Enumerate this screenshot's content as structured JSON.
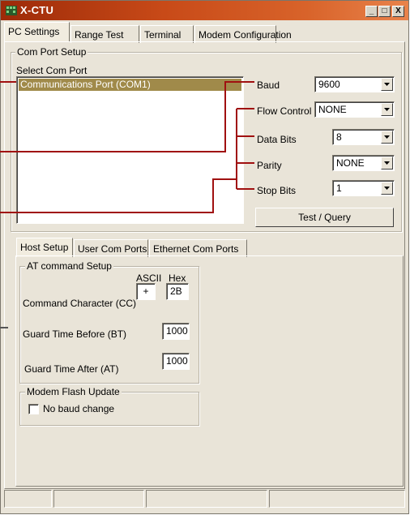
{
  "window": {
    "title": "X-CTU",
    "minimize": "_",
    "maximize": "□",
    "close": "X"
  },
  "main_tabs": [
    "PC Settings",
    "Range Test",
    "Terminal",
    "Modem Configuration"
  ],
  "com_port_setup": {
    "group_label": "Com Port Setup",
    "select_label": "Select Com Port",
    "ports": [
      "Communications Port (COM1)"
    ],
    "selected_index": 0
  },
  "serial": {
    "baud_label": "Baud",
    "baud_value": "9600",
    "flow_label": "Flow Control",
    "flow_value": "NONE",
    "data_bits_label": "Data Bits",
    "data_bits_value": "8",
    "parity_label": "Parity",
    "parity_value": "NONE",
    "stop_bits_label": "Stop Bits",
    "stop_bits_value": "1",
    "test_button": "Test / Query"
  },
  "sub_tabs": [
    "Host Setup",
    "User Com Ports",
    "Ethernet Com Ports"
  ],
  "at_setup": {
    "group_label": "AT command Setup",
    "ascii_header": "ASCII",
    "hex_header": "Hex",
    "cc_label": "Command Character (CC)",
    "cc_ascii": "+",
    "cc_hex": "2B",
    "bt_label": "Guard Time Before (BT)",
    "bt_value": "1000",
    "at_label": "Guard Time After (AT)",
    "at_value": "1000"
  },
  "flash_update": {
    "group_label": "Modem Flash Update",
    "checkbox_label": "No baud change",
    "checked": false
  },
  "colors": {
    "callout": "#a01010",
    "selection": "#a08a4a",
    "titlebar": "#c84a18"
  }
}
